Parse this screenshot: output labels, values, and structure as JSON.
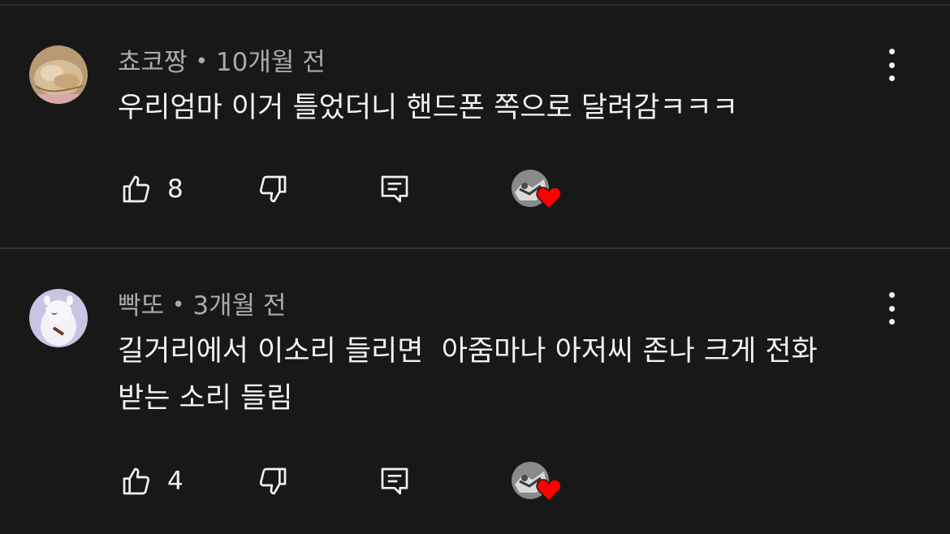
{
  "comments": [
    {
      "author": "쵸코짱",
      "separator": "•",
      "time": "10개월 전",
      "text": "우리엄마 이거 틀었더니 핸드폰 쪽으로 달려감ㅋㅋㅋ",
      "likes": "8",
      "avatar_icon": "cat-avatar"
    },
    {
      "author": "빡또",
      "separator": "•",
      "time": "3개월 전",
      "text": "길거리에서 이소리 들리면  아줌마나 아저씨 존나 크게 전화\n받는 소리 들림",
      "likes": "4",
      "avatar_icon": "moomin-avatar"
    }
  ],
  "colors": {
    "background": "#181818",
    "text": "#f1f1f1",
    "meta": "#aaaaaa",
    "divider": "#2f2f2f",
    "heart": "#ff0000"
  }
}
